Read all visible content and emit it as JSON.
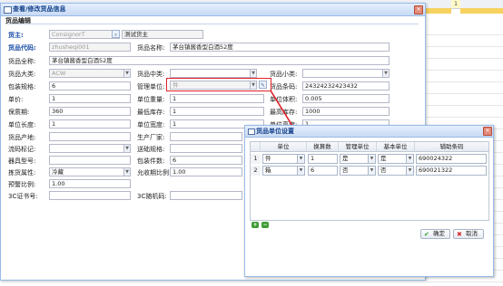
{
  "background": {
    "page_number": "1"
  },
  "main_dialog": {
    "title": "查看/修改货品信息",
    "section": "货品编辑",
    "fields": {
      "owner_label": "货主:",
      "owner_code": "ConsignorT",
      "owner_name": "测试货主",
      "item_code_label": "货品代码:",
      "item_code": "zhusheqi001",
      "item_name_label": "货品名称:",
      "item_name": "茅台镇酱香型白酒52度",
      "full_name_label": "货品全称:",
      "full_name": "茅台镇酱香型白酒52度",
      "category_label": "货品大类:",
      "category": "ACW",
      "mid_category_label": "货品中类:",
      "mid_category": "",
      "sub_category_label": "货品小类:",
      "sub_category": "",
      "pack_spec_label": "包装规格:",
      "pack_spec": "6",
      "unit_label": "管理单位:",
      "unit": "件",
      "barcode_label": "货品条码:",
      "barcode": "24324232423432",
      "price_label": "单价:",
      "price": "1",
      "unit_weight_label": "单位重量:",
      "unit_weight": "1",
      "unit_volume_label": "单位体积:",
      "unit_volume": "0.005",
      "shelf_life_label": "保质期:",
      "shelf_life": "360",
      "min_stock_label": "最低库存:",
      "min_stock": "1",
      "max_stock_label": "最高库存:",
      "max_stock": "1000",
      "unit_length_label": "单位长度:",
      "unit_length": "1",
      "unit_width_label": "单位宽度:",
      "unit_width": "1",
      "unit_height_label": "单位高度:",
      "unit_height": "1",
      "origin_label": "货品产地:",
      "origin": "",
      "manufacturer_label": "生产厂家:",
      "manufacturer": "",
      "flow_mark_label": "流码标记:",
      "flow_mark": "",
      "forward_label": "送础规格:",
      "forward": "",
      "box_type_label": "器具型号:",
      "box_type": "",
      "box_count_label": "包装件数:",
      "box_count": "6",
      "pick_attr_label": "拣货属性:",
      "pick_attr": "冷藏",
      "allow_ratio_label": "允收期比例:",
      "allow_ratio": "1.00",
      "warn_ratio_label": "预警比例:",
      "warn_ratio": "1.00",
      "cert_label": "3C证书号:",
      "cert": "",
      "random_label": "3C随机码:",
      "random": ""
    }
  },
  "unit_dialog": {
    "title": "货品单位设置",
    "columns": [
      "单位",
      "换算数",
      "管理单位",
      "基本单位",
      "辅助条码"
    ],
    "rows": [
      {
        "num": "1",
        "unit": "件",
        "factor": "1",
        "manage": "是",
        "basic": "是",
        "barcode": "690024322"
      },
      {
        "num": "2",
        "unit": "箱",
        "factor": "6",
        "manage": "否",
        "basic": "否",
        "barcode": "690021322"
      }
    ],
    "ok_label": "确定",
    "cancel_label": "取消"
  }
}
